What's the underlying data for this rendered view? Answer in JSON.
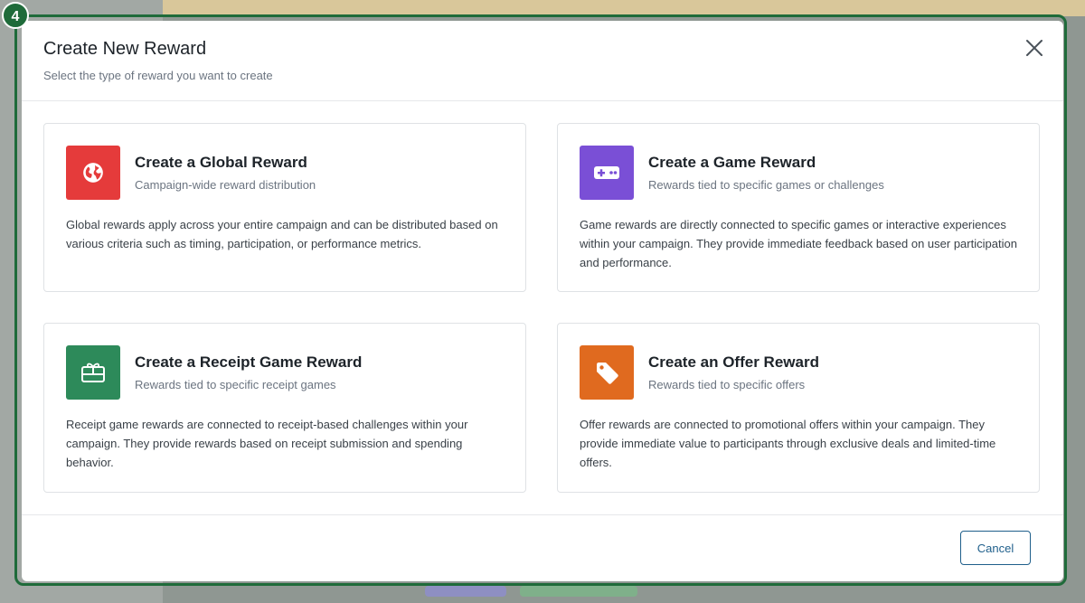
{
  "step_badge": "4",
  "colors": {
    "global": "#e53b3b",
    "game": "#7a4fd6",
    "receipt": "#2d8a5a",
    "offer": "#e06a1f",
    "focus_ring": "#1f6b3a",
    "cancel": "#1f5f8b"
  },
  "modal": {
    "title": "Create New Reward",
    "subtitle": "Select the type of reward you want to create"
  },
  "cards": [
    {
      "icon": "globe-icon",
      "title": "Create a Global Reward",
      "subtitle": "Campaign-wide reward distribution",
      "description": "Global rewards apply across your entire campaign and can be distributed based on various criteria such as timing, participation, or performance metrics."
    },
    {
      "icon": "gamepad-icon",
      "title": "Create a Game Reward",
      "subtitle": "Rewards tied to specific games or challenges",
      "description": "Game rewards are directly connected to specific games or interactive experiences within your campaign. They provide immediate feedback based on user participation and performance."
    },
    {
      "icon": "gift-card-icon",
      "title": "Create a Receipt Game Reward",
      "subtitle": "Rewards tied to specific receipt games",
      "description": "Receipt game rewards are connected to receipt-based challenges within your campaign. They provide rewards based on receipt submission and spending behavior."
    },
    {
      "icon": "tag-icon",
      "title": "Create an Offer Reward",
      "subtitle": "Rewards tied to specific offers",
      "description": "Offer rewards are connected to promotional offers within your campaign. They provide immediate value to participants through exclusive deals and limited-time offers."
    }
  ],
  "footer": {
    "cancel_label": "Cancel"
  }
}
